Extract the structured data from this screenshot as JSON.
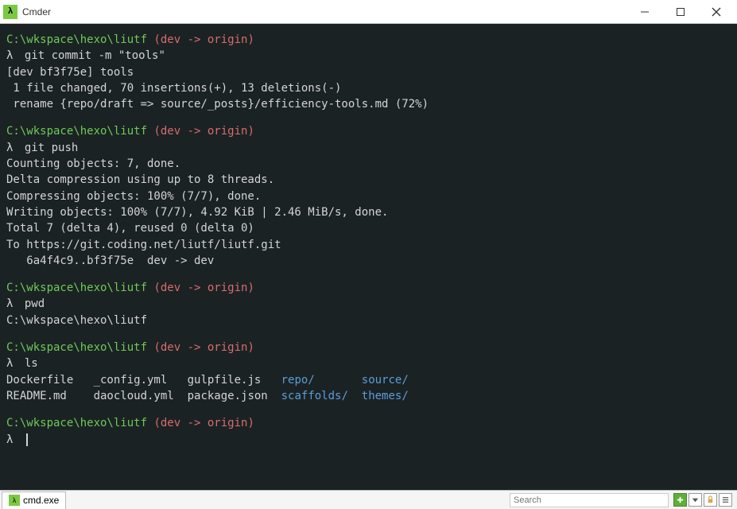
{
  "window": {
    "title": "Cmder",
    "icon_label": "λ"
  },
  "terminal": {
    "blocks": [
      {
        "prompt": "C:\\wkspace\\hexo\\liutf",
        "branch": "(dev -> origin)",
        "command": "git commit -m \"tools\"",
        "output": [
          {
            "t": "[dev bf3f75e] tools"
          },
          {
            "t": " 1 file changed, 70 insertions(+), 13 deletions(-)"
          },
          {
            "t": " rename {repo/draft => source/_posts}/efficiency-tools.md (72%)"
          }
        ]
      },
      {
        "prompt": "C:\\wkspace\\hexo\\liutf",
        "branch": "(dev -> origin)",
        "command": "git push",
        "output": [
          {
            "t": "Counting objects: 7, done."
          },
          {
            "t": "Delta compression using up to 8 threads."
          },
          {
            "t": "Compressing objects: 100% (7/7), done."
          },
          {
            "t": "Writing objects: 100% (7/7), 4.92 KiB | 2.46 MiB/s, done."
          },
          {
            "t": "Total 7 (delta 4), reused 0 (delta 0)"
          },
          {
            "t": "To https://git.coding.net/liutf/liutf.git"
          },
          {
            "t": "   6a4f4c9..bf3f75e  dev -> dev"
          }
        ]
      },
      {
        "prompt": "C:\\wkspace\\hexo\\liutf",
        "branch": "(dev -> origin)",
        "command": "pwd",
        "output": [
          {
            "t": "C:\\wkspace\\hexo\\liutf"
          }
        ]
      },
      {
        "prompt": "C:\\wkspace\\hexo\\liutf",
        "branch": "(dev -> origin)",
        "command": "ls",
        "ls_rows": [
          [
            {
              "txt": "Dockerfile",
              "dir": false,
              "w": 13
            },
            {
              "txt": "_config.yml",
              "dir": false,
              "w": 14
            },
            {
              "txt": "gulpfile.js",
              "dir": false,
              "w": 14
            },
            {
              "txt": "repo/",
              "dir": true,
              "w": 12
            },
            {
              "txt": "source/",
              "dir": true,
              "w": 0
            }
          ],
          [
            {
              "txt": "README.md",
              "dir": false,
              "w": 13
            },
            {
              "txt": "daocloud.yml",
              "dir": false,
              "w": 14
            },
            {
              "txt": "package.json",
              "dir": false,
              "w": 14
            },
            {
              "txt": "scaffolds/",
              "dir": true,
              "w": 12
            },
            {
              "txt": "themes/",
              "dir": true,
              "w": 0
            }
          ]
        ]
      },
      {
        "prompt": "C:\\wkspace\\hexo\\liutf",
        "branch": "(dev -> origin)",
        "command": "",
        "cursor": true
      }
    ],
    "lambda": "λ"
  },
  "statusbar": {
    "tab_label": "cmd.exe",
    "search_placeholder": "Search"
  }
}
